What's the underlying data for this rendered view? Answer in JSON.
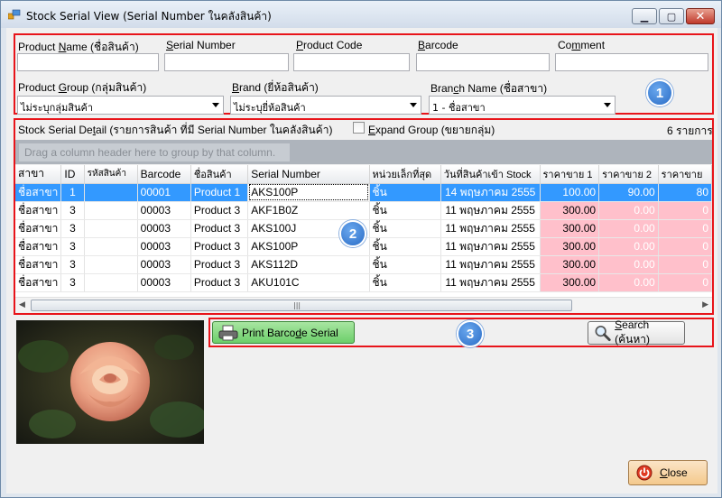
{
  "window": {
    "title": "Stock Serial View (Serial Number ในคลังสินค้า)",
    "controls": [
      "minimize",
      "maximize",
      "close"
    ]
  },
  "filters": {
    "product_name": {
      "label_pre": "Product ",
      "label_u": "N",
      "label_post": "ame (ชื่อสินค้า)",
      "value": ""
    },
    "serial_number": {
      "label_pre": "",
      "label_u": "S",
      "label_post": "erial Number",
      "value": ""
    },
    "product_code": {
      "label_pre": "",
      "label_u": "P",
      "label_post": "roduct Code",
      "value": ""
    },
    "barcode": {
      "label_pre": "",
      "label_u": "B",
      "label_post": "arcode",
      "value": ""
    },
    "comment": {
      "label_pre": "Co",
      "label_u": "m",
      "label_post": "ment",
      "value": ""
    },
    "product_group": {
      "label_pre": "Product ",
      "label_u": "G",
      "label_post": "roup (กลุ่มสินค้า)",
      "value": "ไม่ระบุกลุ่มสินค้า"
    },
    "brand": {
      "label_pre": "",
      "label_u": "B",
      "label_post": "rand (ยี่ห้อสินค้า)",
      "value": "ไม่ระบุยี่ห้อสินค้า"
    },
    "branch_name": {
      "label_pre": "Bran",
      "label_u": "c",
      "label_post": "h Name (ชื่อสาขา)",
      "value": "1 - ชื่อสาขา"
    }
  },
  "badges": [
    "1",
    "2",
    "3"
  ],
  "detail": {
    "title_pre": "Stock Serial De",
    "title_u": "t",
    "title_post": "ail (รายการสินค้า ที่มี Serial Number ในคลังสินค้า)",
    "expand_pre": "",
    "expand_u": "E",
    "expand_post": "xpand Group (ขยายกลุ่ม)",
    "expand_checked": false,
    "count_text": "6 รายการ",
    "group_hint": "Drag a column header here to group by that column."
  },
  "grid": {
    "columns": [
      "สาขา",
      "ID",
      "รหัสสินค้า",
      "Barcode",
      "ชื่อสินค้า",
      "Serial Number",
      "หน่วยเล็กที่สุด",
      "วันที่สินค้าเข้า Stock",
      "ราคาขาย 1",
      "ราคาขาย 2",
      "ราคาขาย"
    ],
    "rows": [
      [
        "ชื่อสาขา",
        "1",
        "",
        "00001",
        "Product 1",
        "AKS100P",
        "ชิ้น",
        "14 พฤษภาคม 2555",
        "100.00",
        "90.00",
        "80"
      ],
      [
        "ชื่อสาขา",
        "3",
        "",
        "00003",
        "Product 3",
        "AKF1B0Z",
        "ชิ้น",
        "11 พฤษภาคม 2555",
        "300.00",
        "0.00",
        "0"
      ],
      [
        "ชื่อสาขา",
        "3",
        "",
        "00003",
        "Product 3",
        "AKS100J",
        "ชิ้น",
        "11 พฤษภาคม 2555",
        "300.00",
        "0.00",
        "0"
      ],
      [
        "ชื่อสาขา",
        "3",
        "",
        "00003",
        "Product 3",
        "AKS100P",
        "ชิ้น",
        "11 พฤษภาคม 2555",
        "300.00",
        "0.00",
        "0"
      ],
      [
        "ชื่อสาขา",
        "3",
        "",
        "00003",
        "Product 3",
        "AKS112D",
        "ชิ้น",
        "11 พฤษภาคม 2555",
        "300.00",
        "0.00",
        "0"
      ],
      [
        "ชื่อสาขา",
        "3",
        "",
        "00003",
        "Product 3",
        "AKU101C",
        "ชิ้น",
        "11 พฤษภาคม 2555",
        "300.00",
        "0.00",
        "0"
      ]
    ],
    "selected_row": 0
  },
  "buttons": {
    "print": {
      "pre": "Print Barco",
      "u": "d",
      "post": "e Serial",
      "icon": "printer-icon"
    },
    "search": {
      "pre": "",
      "u": "S",
      "post": "earch (ค้นหา)",
      "icon": "magnifier-icon"
    },
    "close": {
      "pre": "",
      "u": "C",
      "post": "lose",
      "icon": "power-icon"
    }
  },
  "colors": {
    "highlight_box": "#e8141a",
    "selection": "#3399ff",
    "price_highlight": "#ffc0cb",
    "badge": "#2a6cc6"
  }
}
